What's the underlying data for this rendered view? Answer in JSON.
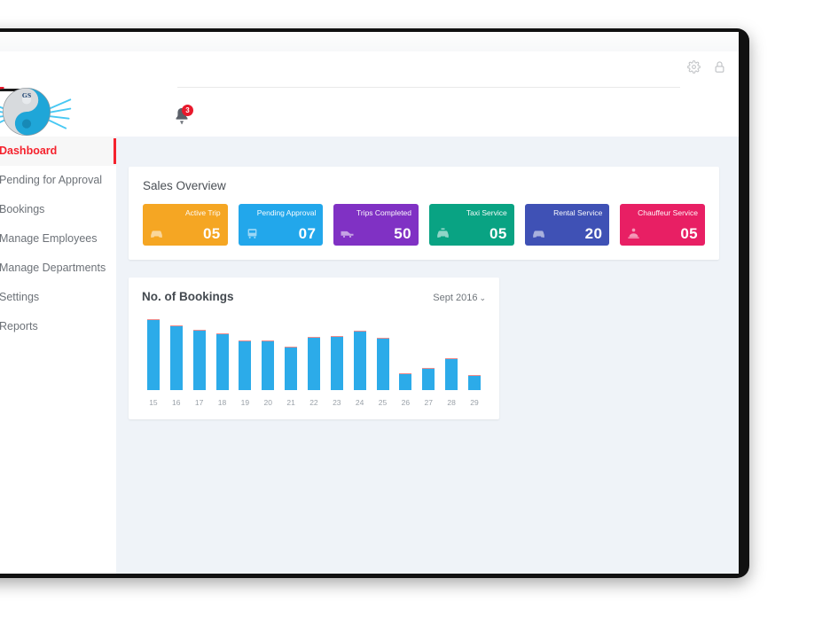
{
  "window": {
    "topbar": {
      "gear_icon": "gear-icon",
      "lock_icon": "lock-icon"
    }
  },
  "header": {
    "notifications": {
      "icon": "bell-icon",
      "badge_count": "3"
    }
  },
  "sidebar": {
    "logo": {
      "icon": "company-logo-swirl-wings",
      "alt": "GS"
    },
    "items": [
      {
        "label": "Dashboard",
        "active": true
      },
      {
        "label": "Pending for Approval",
        "active": false
      },
      {
        "label": "Bookings",
        "active": false
      },
      {
        "label": "Manage Employees",
        "active": false
      },
      {
        "label": "Manage Departments",
        "active": false
      },
      {
        "label": "Settings",
        "active": false
      },
      {
        "label": "Reports",
        "active": false
      }
    ]
  },
  "main": {
    "sales_overview": {
      "title": "Sales Overview",
      "stats": [
        {
          "label": "Active Trip",
          "value": "05",
          "color": "#f5a623",
          "icon": "car-icon"
        },
        {
          "label": "Pending Approval",
          "value": "07",
          "color": "#22a7eb",
          "icon": "bus-icon"
        },
        {
          "label": "Trips Completed",
          "value": "50",
          "color": "#8031c4",
          "icon": "van-icon"
        },
        {
          "label": "Taxi Service",
          "value": "05",
          "color": "#09a383",
          "icon": "taxi-icon"
        },
        {
          "label": "Rental Service",
          "value": "20",
          "color": "#3f51b5",
          "icon": "car-icon"
        },
        {
          "label": "Chauffeur Service",
          "value": "05",
          "color": "#e81f64",
          "icon": "driver-icon"
        }
      ]
    },
    "bookings_chart": {
      "title": "No. of Bookings",
      "period_selected": "Sept 2016",
      "period_caret": "⌄"
    }
  },
  "chart_data": {
    "type": "bar",
    "title": "No. of Bookings",
    "xlabel": "",
    "ylabel": "",
    "categories": [
      "15",
      "16",
      "17",
      "18",
      "19",
      "20",
      "21",
      "22",
      "23",
      "24",
      "25",
      "26",
      "27",
      "28",
      "29"
    ],
    "values": [
      76,
      70,
      65,
      61,
      53,
      53,
      47,
      57,
      58,
      64,
      56,
      18,
      24,
      34,
      16
    ],
    "ylim": [
      0,
      80
    ],
    "grid": false,
    "legend": false,
    "bar_color": "#2cabe9"
  }
}
